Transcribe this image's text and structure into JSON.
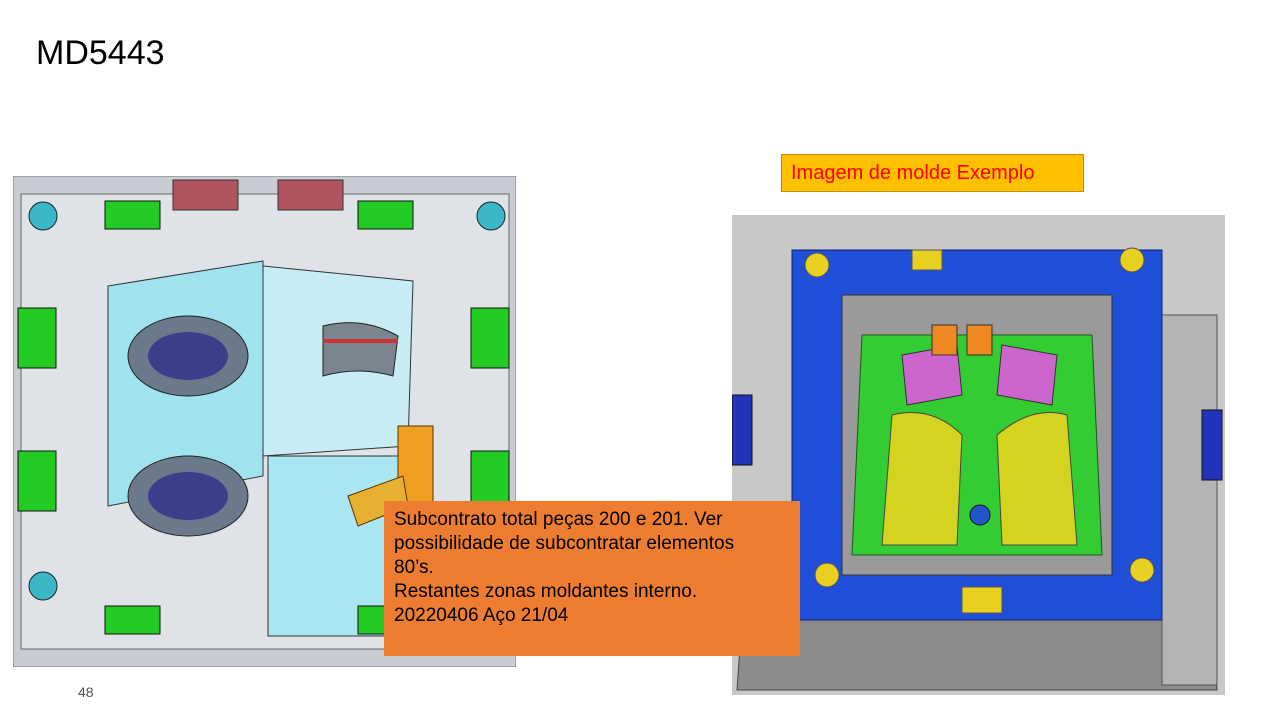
{
  "slide": {
    "title": "MD5443",
    "page_number": "48"
  },
  "example_label": "Imagem de molde Exemplo",
  "note": {
    "lines": [
      "Subcontrato total peças 200 e 201. Ver",
      "possibilidade de subcontratar elementos",
      "80’s.",
      "Restantes zonas moldantes interno.",
      "20220406 Aço 21/04"
    ]
  },
  "colors": {
    "label_bg": "#ffc000",
    "label_text": "#ff0000",
    "note_bg": "#ed7d31"
  }
}
